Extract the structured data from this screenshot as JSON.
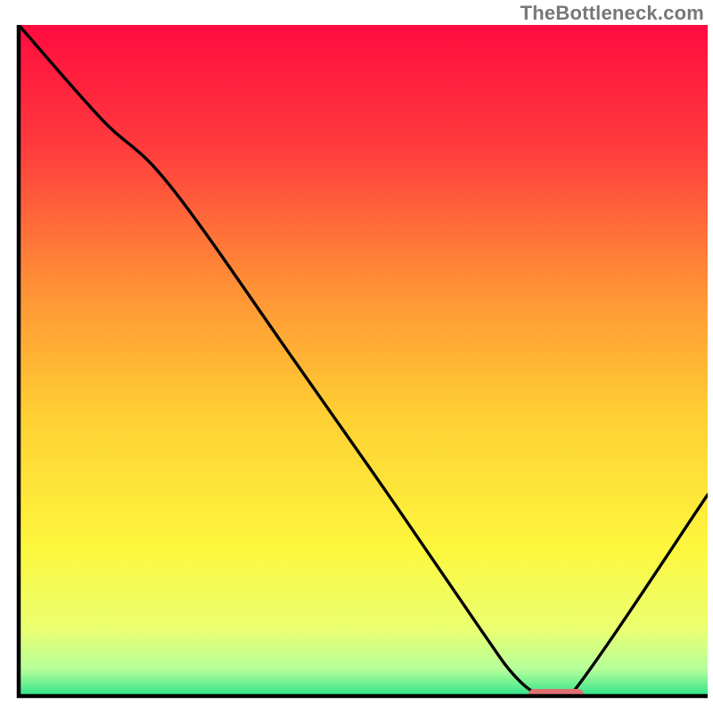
{
  "watermark": "TheBottleneck.com",
  "chart_data": {
    "type": "line",
    "title": "",
    "xlabel": "",
    "ylabel": "",
    "xlim": [
      0,
      100
    ],
    "ylim": [
      0,
      100
    ],
    "grid": false,
    "series": [
      {
        "name": "curve",
        "x": [
          0,
          12,
          22,
          40,
          55,
          67,
          72,
          76,
          80,
          100
        ],
        "y": [
          100,
          86,
          76,
          50,
          28,
          10,
          3,
          0,
          0,
          30
        ]
      }
    ],
    "marker": {
      "x_start": 74,
      "x_end": 82,
      "y": 0
    },
    "background": {
      "type": "heatmap-gradient",
      "direction": "vertical",
      "stops": [
        {
          "pos": 0.0,
          "color": "#ff0b3f"
        },
        {
          "pos": 0.18,
          "color": "#ff3b3d"
        },
        {
          "pos": 0.38,
          "color": "#ff8d36"
        },
        {
          "pos": 0.58,
          "color": "#ffcf33"
        },
        {
          "pos": 0.78,
          "color": "#fdf73e"
        },
        {
          "pos": 0.9,
          "color": "#eaff70"
        },
        {
          "pos": 0.96,
          "color": "#b6ff9a"
        },
        {
          "pos": 1.0,
          "color": "#2fe38a"
        }
      ]
    }
  }
}
